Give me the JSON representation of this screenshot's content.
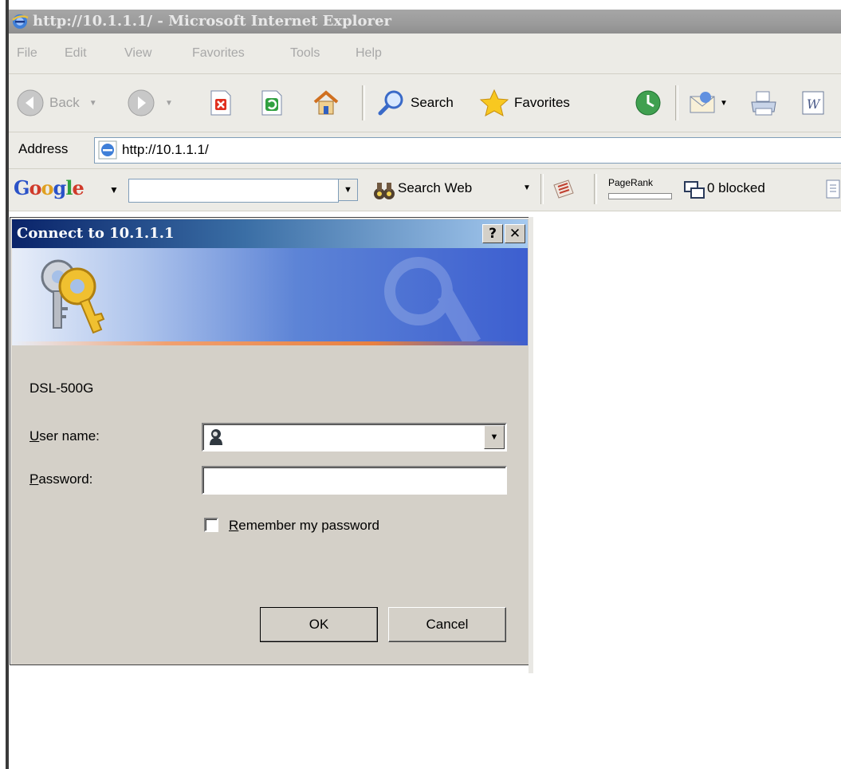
{
  "window": {
    "title": "http://10.1.1.1/ - Microsoft Internet Explorer"
  },
  "menu": [
    "File",
    "Edit",
    "View",
    "Favorites",
    "Tools",
    "Help"
  ],
  "toolbar": {
    "back_label": "Back",
    "search_label": "Search",
    "favorites_label": "Favorites"
  },
  "address": {
    "label": "Address",
    "url": "http://10.1.1.1/"
  },
  "google_toolbar": {
    "search_web_label": "Search Web",
    "pagerank_label": "PageRank",
    "blocked_label": "0 blocked",
    "query": ""
  },
  "dialog": {
    "title": "Connect to 10.1.1.1",
    "help_glyph": "?",
    "close_glyph": "✕",
    "realm": "DSL-500G",
    "user_label_first": "U",
    "user_label_rest": "ser name:",
    "user_value": "",
    "password_label_first": "P",
    "password_label_rest": "assword:",
    "password_value": "",
    "remember_first": "R",
    "remember_rest": "emember my password",
    "remember_checked": false,
    "ok_label": "OK",
    "cancel_label": "Cancel"
  },
  "colors": {
    "dialog_title_start": "#0a246a",
    "dialog_title_end": "#a6caf0",
    "chrome": "#ecebe6",
    "dialog_face": "#d4d0c8"
  }
}
